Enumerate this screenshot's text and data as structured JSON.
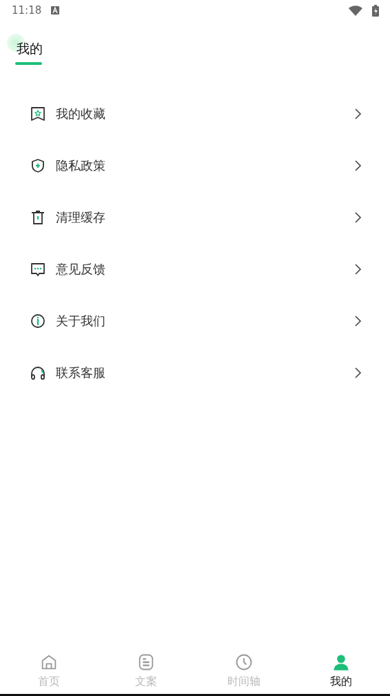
{
  "status_bar": {
    "time": "11:18"
  },
  "header": {
    "title": "我的"
  },
  "menu": [
    {
      "kind": "favorites",
      "label": "我的收藏"
    },
    {
      "kind": "privacy",
      "label": "隐私政策"
    },
    {
      "kind": "cache",
      "label": "清理缓存"
    },
    {
      "kind": "feedback",
      "label": "意见反馈"
    },
    {
      "kind": "about",
      "label": "关于我们"
    },
    {
      "kind": "support",
      "label": "联系客服"
    }
  ],
  "tabs": [
    {
      "kind": "home",
      "label": "首页",
      "selected": false
    },
    {
      "kind": "copy",
      "label": "文案",
      "selected": false
    },
    {
      "kind": "timeline",
      "label": "时间轴",
      "selected": false
    },
    {
      "kind": "me",
      "label": "我的",
      "selected": true
    }
  ]
}
